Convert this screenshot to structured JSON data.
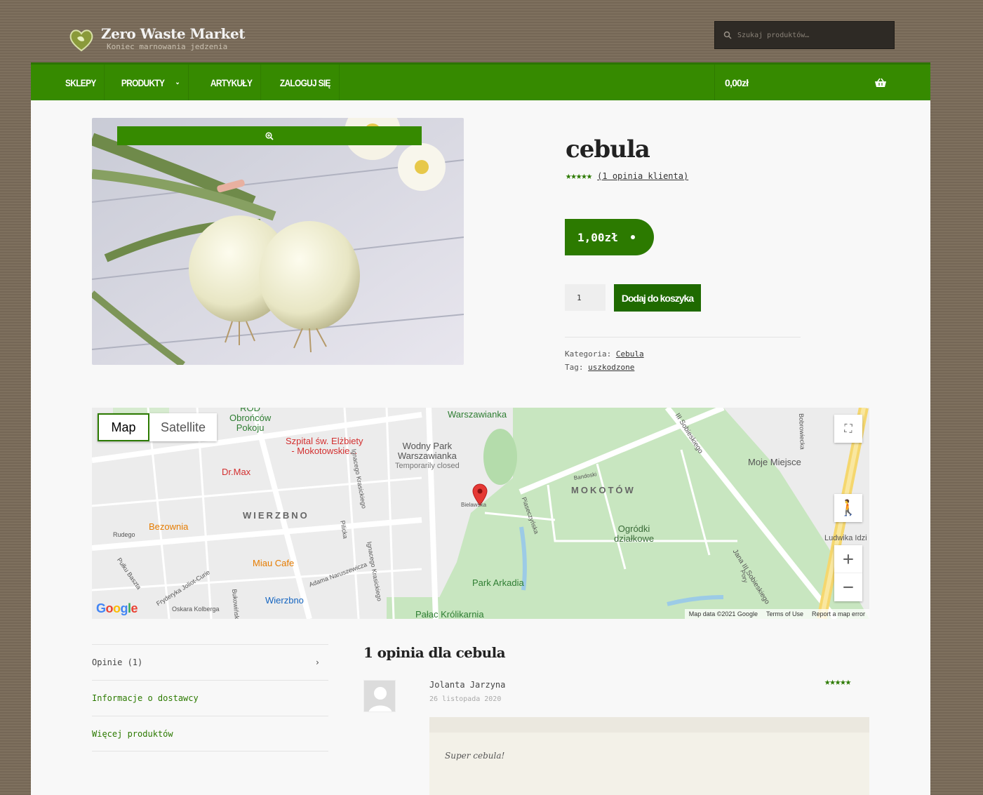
{
  "site": {
    "title": "Zero Waste Market",
    "tagline": "Koniec marnowania jedzenia"
  },
  "search": {
    "placeholder": "Szukaj produktów…"
  },
  "nav": {
    "items": [
      "SKLEPY",
      "PRODUKTY",
      "ARTYKUŁY",
      "ZALOGUJ SIĘ"
    ],
    "cart_total": "0,00zł"
  },
  "product": {
    "title": "cebula",
    "rating": 5,
    "review_link": "(1 opinia klienta)",
    "price": "1,00zł",
    "quantity": "1",
    "add_to_cart": "Dodaj do koszyka",
    "category_label": "Kategoria:",
    "category": "Cebula",
    "tag_label": "Tag:",
    "tag": "uszkodzone"
  },
  "map": {
    "toggle": [
      "Map",
      "Satellite"
    ],
    "labels": {
      "warszawianka": "Warszawianka",
      "rod": "ROD",
      "obroncow": "Obrońców",
      "pokoju": "Pokoju",
      "szpital1": "Szpital św. Elżbiety",
      "szpital2": "- Mokotowskie...",
      "park1": "Wodny Park",
      "park2": "Warszawianka",
      "closed": "Temporarily closed",
      "drmax": "Dr.Max",
      "mokotow": "MOKOTÓW",
      "wierzbno": "WIERZBNO",
      "bezownia": "Bezownia",
      "miau": "Miau Cafe",
      "ogrodki1": "Ogródki",
      "ogrodki2": "działkowe",
      "arkadia": "Park Arkadia",
      "wierzbno_stop": "Wierzbno",
      "palac": "Pałac Królikarnia",
      "moje": "Moje Miejsce",
      "ludwika": "Ludwika Idzi",
      "sobieskiego": "Jana III Sobieskiego",
      "sobieskiego2": "III Sobieskiego",
      "naruszewicza": "Adama Naruszewicza",
      "krasickiego": "Ignacego Krasickiego",
      "kolberga": "Oskara Kolberga",
      "joliot": "Fryderyka Joliot-Curie",
      "baszta": "Pułku Baszta",
      "rudego": "Rudego",
      "pilicka": "Pilicka",
      "bukowinska": "Bukowińska",
      "pory": "Pory",
      "bobrowiecka": "Bobrowiecka",
      "pieseczynska": "Piaseczyńska",
      "bielawska": "Bielawska",
      "bandoski": "Bandoski"
    },
    "attribution": [
      "Map data ©2021 Google",
      "Terms of Use",
      "Report a map error"
    ]
  },
  "tabs": [
    "Opinie (1)",
    "Informacje o dostawcy",
    "Więcej produktów"
  ],
  "reviews": {
    "title": "1 opinia dla cebula",
    "author": "Jolanta Jarzyna",
    "date": "26 listopada 2020",
    "rating": 5,
    "text": "Super cebula!"
  },
  "colors": {
    "brand_green": "#368a00",
    "dark_green": "#1f6a00",
    "background": "#7a6b59"
  }
}
